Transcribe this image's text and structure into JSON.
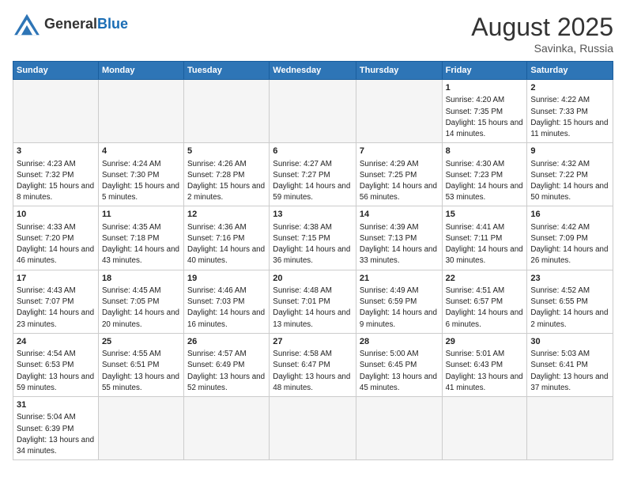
{
  "header": {
    "logo": {
      "general": "General",
      "blue": "Blue"
    },
    "title": "August 2025",
    "location": "Savinka, Russia"
  },
  "weekdays": [
    "Sunday",
    "Monday",
    "Tuesday",
    "Wednesday",
    "Thursday",
    "Friday",
    "Saturday"
  ],
  "weeks": [
    [
      {
        "day": "",
        "info": ""
      },
      {
        "day": "",
        "info": ""
      },
      {
        "day": "",
        "info": ""
      },
      {
        "day": "",
        "info": ""
      },
      {
        "day": "",
        "info": ""
      },
      {
        "day": "1",
        "info": "Sunrise: 4:20 AM\nSunset: 7:35 PM\nDaylight: 15 hours\nand 14 minutes."
      },
      {
        "day": "2",
        "info": "Sunrise: 4:22 AM\nSunset: 7:33 PM\nDaylight: 15 hours\nand 11 minutes."
      }
    ],
    [
      {
        "day": "3",
        "info": "Sunrise: 4:23 AM\nSunset: 7:32 PM\nDaylight: 15 hours\nand 8 minutes."
      },
      {
        "day": "4",
        "info": "Sunrise: 4:24 AM\nSunset: 7:30 PM\nDaylight: 15 hours\nand 5 minutes."
      },
      {
        "day": "5",
        "info": "Sunrise: 4:26 AM\nSunset: 7:28 PM\nDaylight: 15 hours\nand 2 minutes."
      },
      {
        "day": "6",
        "info": "Sunrise: 4:27 AM\nSunset: 7:27 PM\nDaylight: 14 hours\nand 59 minutes."
      },
      {
        "day": "7",
        "info": "Sunrise: 4:29 AM\nSunset: 7:25 PM\nDaylight: 14 hours\nand 56 minutes."
      },
      {
        "day": "8",
        "info": "Sunrise: 4:30 AM\nSunset: 7:23 PM\nDaylight: 14 hours\nand 53 minutes."
      },
      {
        "day": "9",
        "info": "Sunrise: 4:32 AM\nSunset: 7:22 PM\nDaylight: 14 hours\nand 50 minutes."
      }
    ],
    [
      {
        "day": "10",
        "info": "Sunrise: 4:33 AM\nSunset: 7:20 PM\nDaylight: 14 hours\nand 46 minutes."
      },
      {
        "day": "11",
        "info": "Sunrise: 4:35 AM\nSunset: 7:18 PM\nDaylight: 14 hours\nand 43 minutes."
      },
      {
        "day": "12",
        "info": "Sunrise: 4:36 AM\nSunset: 7:16 PM\nDaylight: 14 hours\nand 40 minutes."
      },
      {
        "day": "13",
        "info": "Sunrise: 4:38 AM\nSunset: 7:15 PM\nDaylight: 14 hours\nand 36 minutes."
      },
      {
        "day": "14",
        "info": "Sunrise: 4:39 AM\nSunset: 7:13 PM\nDaylight: 14 hours\nand 33 minutes."
      },
      {
        "day": "15",
        "info": "Sunrise: 4:41 AM\nSunset: 7:11 PM\nDaylight: 14 hours\nand 30 minutes."
      },
      {
        "day": "16",
        "info": "Sunrise: 4:42 AM\nSunset: 7:09 PM\nDaylight: 14 hours\nand 26 minutes."
      }
    ],
    [
      {
        "day": "17",
        "info": "Sunrise: 4:43 AM\nSunset: 7:07 PM\nDaylight: 14 hours\nand 23 minutes."
      },
      {
        "day": "18",
        "info": "Sunrise: 4:45 AM\nSunset: 7:05 PM\nDaylight: 14 hours\nand 20 minutes."
      },
      {
        "day": "19",
        "info": "Sunrise: 4:46 AM\nSunset: 7:03 PM\nDaylight: 14 hours\nand 16 minutes."
      },
      {
        "day": "20",
        "info": "Sunrise: 4:48 AM\nSunset: 7:01 PM\nDaylight: 14 hours\nand 13 minutes."
      },
      {
        "day": "21",
        "info": "Sunrise: 4:49 AM\nSunset: 6:59 PM\nDaylight: 14 hours\nand 9 minutes."
      },
      {
        "day": "22",
        "info": "Sunrise: 4:51 AM\nSunset: 6:57 PM\nDaylight: 14 hours\nand 6 minutes."
      },
      {
        "day": "23",
        "info": "Sunrise: 4:52 AM\nSunset: 6:55 PM\nDaylight: 14 hours\nand 2 minutes."
      }
    ],
    [
      {
        "day": "24",
        "info": "Sunrise: 4:54 AM\nSunset: 6:53 PM\nDaylight: 13 hours\nand 59 minutes."
      },
      {
        "day": "25",
        "info": "Sunrise: 4:55 AM\nSunset: 6:51 PM\nDaylight: 13 hours\nand 55 minutes."
      },
      {
        "day": "26",
        "info": "Sunrise: 4:57 AM\nSunset: 6:49 PM\nDaylight: 13 hours\nand 52 minutes."
      },
      {
        "day": "27",
        "info": "Sunrise: 4:58 AM\nSunset: 6:47 PM\nDaylight: 13 hours\nand 48 minutes."
      },
      {
        "day": "28",
        "info": "Sunrise: 5:00 AM\nSunset: 6:45 PM\nDaylight: 13 hours\nand 45 minutes."
      },
      {
        "day": "29",
        "info": "Sunrise: 5:01 AM\nSunset: 6:43 PM\nDaylight: 13 hours\nand 41 minutes."
      },
      {
        "day": "30",
        "info": "Sunrise: 5:03 AM\nSunset: 6:41 PM\nDaylight: 13 hours\nand 37 minutes."
      }
    ],
    [
      {
        "day": "31",
        "info": "Sunrise: 5:04 AM\nSunset: 6:39 PM\nDaylight: 13 hours\nand 34 minutes."
      },
      {
        "day": "",
        "info": ""
      },
      {
        "day": "",
        "info": ""
      },
      {
        "day": "",
        "info": ""
      },
      {
        "day": "",
        "info": ""
      },
      {
        "day": "",
        "info": ""
      },
      {
        "day": "",
        "info": ""
      }
    ]
  ]
}
